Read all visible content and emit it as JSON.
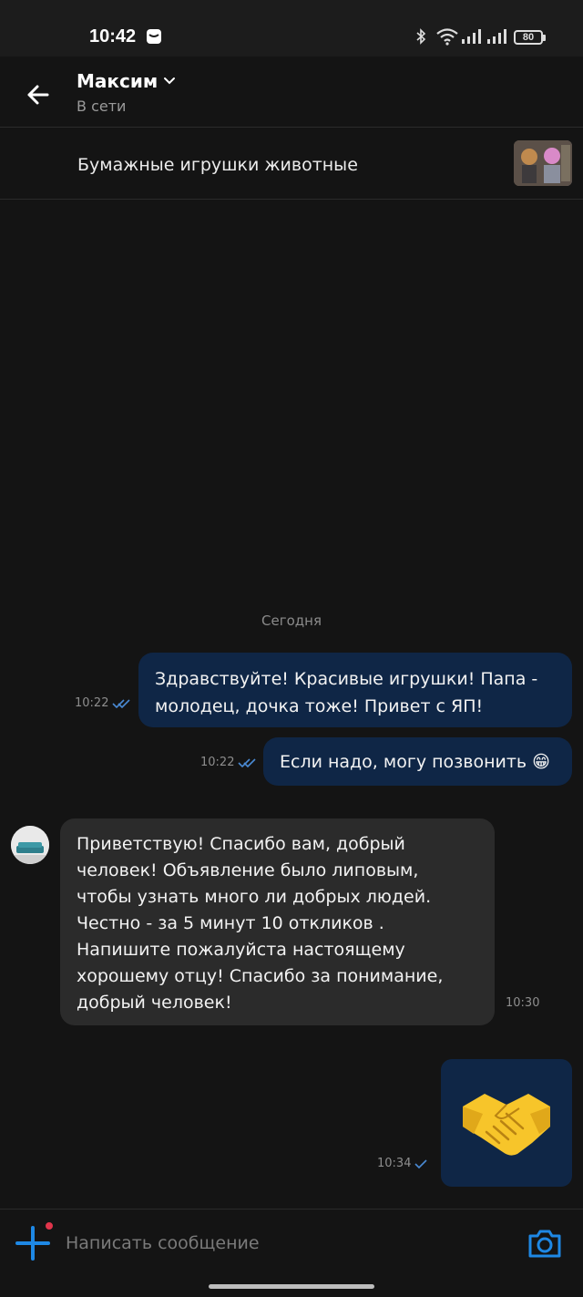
{
  "status_bar": {
    "time": "10:42",
    "battery": "80"
  },
  "header": {
    "contact_name": "Максим",
    "contact_status": "В сети"
  },
  "ad": {
    "title": "Бумажные игрушки животные"
  },
  "chat": {
    "date_separator": "Сегодня",
    "messages": [
      {
        "direction": "outgoing",
        "text": "Здравствуйте! Красивые игрушки! Папа - молодец, дочка тоже! Привет с ЯП!",
        "line1": "Здравствуйте! Красивые игрушки! Папа -",
        "line2": "молодец, дочка тоже! Привет с ЯП!",
        "time": "10:22",
        "status": "read"
      },
      {
        "direction": "outgoing",
        "text": "Если надо, могу позвонить 😁",
        "time": "10:22",
        "status": "read"
      },
      {
        "direction": "incoming",
        "lines": [
          "Приветствую! Спасибо вам, добрый",
          "человек! Объявление было липовым,",
          "чтобы узнать много ли добрых людей.",
          "Честно - за 5 минут 10 откликов .",
          "Напишите пожалуйста настоящему",
          "хорошему отцу! Спасибо за понимание,",
          "добрый человек!"
        ],
        "time": "10:30"
      },
      {
        "direction": "outgoing",
        "emoji": "🤝",
        "time": "10:34",
        "status": "sent"
      }
    ]
  },
  "input": {
    "placeholder": "Написать сообщение"
  },
  "colors": {
    "background": "#141414",
    "outgoing_bubble": "#0f2646",
    "incoming_bubble": "#2b2b2b",
    "accent": "#1e88e5",
    "notification_dot": "#e0354b"
  }
}
